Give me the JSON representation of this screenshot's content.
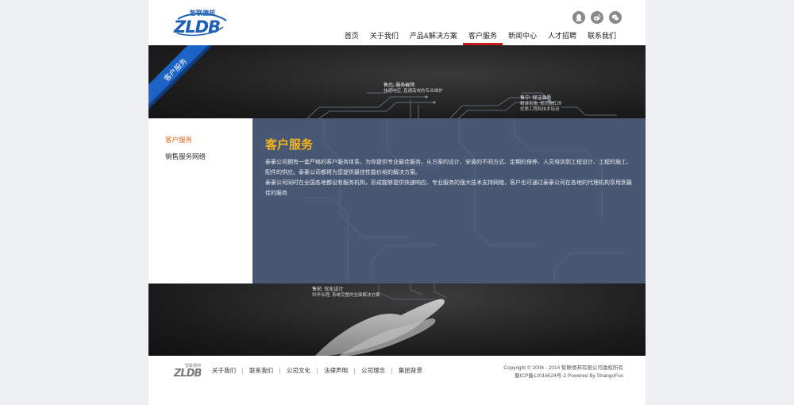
{
  "header": {
    "logo_text": "ZLDB",
    "logo_cn": "智联德邦",
    "social": [
      "qq-icon",
      "weibo-icon",
      "wechat-icon"
    ],
    "nav": [
      {
        "label": "首页",
        "active": false
      },
      {
        "label": "关于我们",
        "active": false
      },
      {
        "label": "产品&解决方案",
        "active": false
      },
      {
        "label": "客户服务",
        "active": true
      },
      {
        "label": "新闻中心",
        "active": false
      },
      {
        "label": "人才招聘",
        "active": false
      },
      {
        "label": "联系我们",
        "active": false
      }
    ]
  },
  "banner": {
    "ribbon": "客户服务",
    "annotations": [
      {
        "title": "售后: 服务保障",
        "desc": "快速响应, 直通高效的专业维护"
      },
      {
        "title": "售中: 保证品质",
        "desc": "精准实施, 规范施工的\n优质工程和技术培训"
      }
    ]
  },
  "sidebar": {
    "items": [
      {
        "label": "客户服务",
        "active": true
      },
      {
        "label": "销售服务网络",
        "active": false
      }
    ]
  },
  "main": {
    "title": "客户服务",
    "paragraphs": [
      "泰豪公司拥有一套严格的客户服务体系，为你提供专业最佳服务，从方案的设计、安装的不同方式、定期的保养、人员培训到工程设计、工程的施工、配件的供应。泰豪公司都将为您提供最佳性能价格的解决方案。",
      "泰豪公司同时在全国各地都设有服务机构，形成能够提供快速响应、专业服务的强大技术支持网络，客户也可通过泰豪公司在各地的代理机构享用到最佳的服务"
    ]
  },
  "hands_banner": {
    "title": "售前: 优化设计",
    "desc": "科学合理, 系统完整的全面解决方案"
  },
  "footer": {
    "logo_text": "ZLDB",
    "logo_cn": "智联德邦",
    "links": [
      "关于我们",
      "联系我们",
      "公司文化",
      "法律声明",
      "公司理念",
      "集团背景"
    ],
    "copyright": "Copyright © 2006 - 2014 智联德邦有限公司版权所有",
    "icp": "蜀ICP备12016524号-2 Powered By ShangoFox"
  },
  "colors": {
    "accent_red": "#c51c1c",
    "ribbon_blue": "#1d63c6",
    "title_yellow": "#f5b519",
    "sidebar_active": "#e06a1b",
    "panel_bg": "#485873"
  }
}
